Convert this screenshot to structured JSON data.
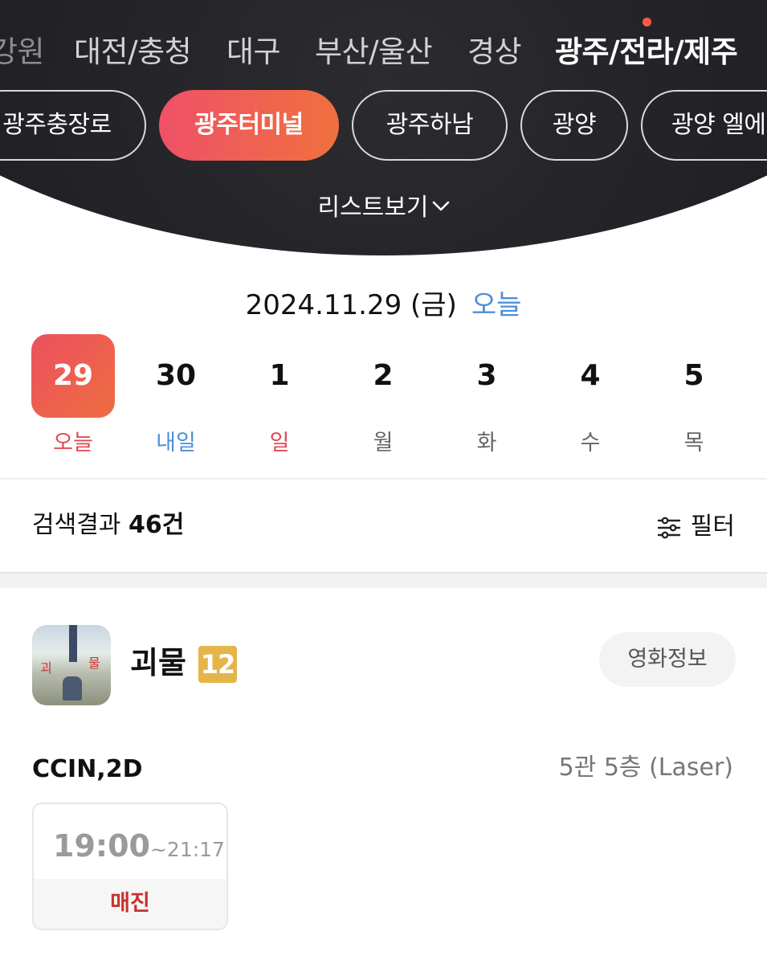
{
  "regions": [
    {
      "label": "강원"
    },
    {
      "label": "대전/충청"
    },
    {
      "label": "대구"
    },
    {
      "label": "부산/울산"
    },
    {
      "label": "경상"
    },
    {
      "label": "광주/전라/제주",
      "active": true
    }
  ],
  "theaters": [
    {
      "label": "광주충장로"
    },
    {
      "label": "광주터미널",
      "active": true
    },
    {
      "label": "광주하남"
    },
    {
      "label": "광양"
    },
    {
      "label": "광양 엘에이"
    }
  ],
  "list_view_label": "리스트보기",
  "date": {
    "full": "2024.11.29 (금)",
    "today_link": "오늘"
  },
  "days": [
    {
      "num": "29",
      "label": "오늘",
      "selected": true
    },
    {
      "num": "30",
      "label": "내일"
    },
    {
      "num": "1",
      "label": "일"
    },
    {
      "num": "2",
      "label": "월"
    },
    {
      "num": "3",
      "label": "화"
    },
    {
      "num": "4",
      "label": "수"
    },
    {
      "num": "5",
      "label": "목"
    }
  ],
  "results": {
    "prefix": "검색결과",
    "count": "46건"
  },
  "filter_label": "필터",
  "movie": {
    "title": "괴물",
    "age_rating": "12",
    "info_button": "영화정보",
    "poster_text_left": "괴",
    "poster_text_right": "물",
    "format": "CCIN,2D",
    "hall": "5관 5층 (Laser)",
    "showtimes": [
      {
        "start": "19:00",
        "end": "~21:17",
        "status": "매진"
      }
    ]
  },
  "colors": {
    "accent_gradient_start": "#ef5168",
    "accent_gradient_end": "#f0703e",
    "today_blue": "#4f8fd8",
    "sunday_red": "#e04a52",
    "sold_out_red": "#c9312c",
    "age_badge_yellow": "#e5b54a"
  }
}
